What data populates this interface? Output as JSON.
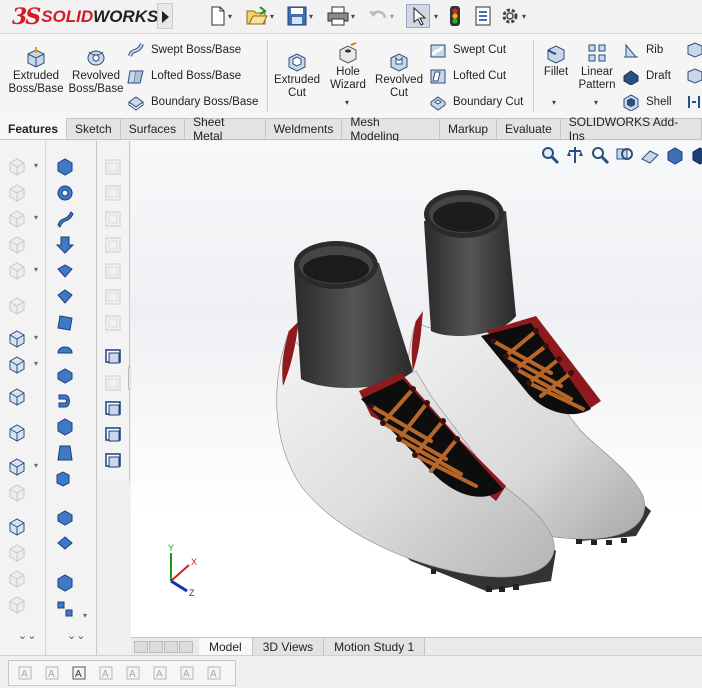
{
  "app": {
    "logo_mark": "3S",
    "logo_solid": "SOLID",
    "logo_works": "WORKS"
  },
  "quick_access": [
    {
      "name": "new-document",
      "icon": "new-file-icon"
    },
    {
      "name": "open",
      "icon": "open-folder-icon"
    },
    {
      "name": "save",
      "icon": "save-icon"
    },
    {
      "name": "print",
      "icon": "printer-icon"
    },
    {
      "name": "undo",
      "icon": "undo-icon"
    },
    {
      "name": "select",
      "icon": "cursor-icon"
    },
    {
      "name": "rebuild",
      "icon": "traffic-light-icon"
    },
    {
      "name": "file-properties",
      "icon": "file-properties-icon"
    },
    {
      "name": "options",
      "icon": "gear-icon"
    }
  ],
  "commands": {
    "extruded_boss": "Extruded\nBoss/Base",
    "revolved_boss": "Revolved\nBoss/Base",
    "swept_boss": "Swept Boss/Base",
    "lofted_boss": "Lofted Boss/Base",
    "boundary_boss": "Boundary Boss/Base",
    "extruded_cut": "Extruded\nCut",
    "hole_wizard": "Hole\nWizard",
    "revolved_cut": "Revolved\nCut",
    "swept_cut": "Swept Cut",
    "lofted_cut": "Lofted Cut",
    "boundary_cut": "Boundary Cut",
    "fillet": "Fillet",
    "linear_pattern": "Linear\nPattern",
    "rib": "Rib",
    "draft": "Draft",
    "shell": "Shell"
  },
  "tabs": [
    "Features",
    "Sketch",
    "Surfaces",
    "Sheet Metal",
    "Weldments",
    "Mesh Modeling",
    "Markup",
    "Evaluate",
    "SOLIDWORKS Add-Ins"
  ],
  "active_tab": "Features",
  "bottom_tabs": [
    "Model",
    "3D Views",
    "Motion Study 1"
  ],
  "active_bottom_tab": "Model",
  "triad": {
    "x": "X",
    "y": "Y",
    "z": "Z"
  },
  "colors": {
    "brand_red": "#d31b24",
    "shoe_body": "#d9d9d9",
    "shoe_collar": "#3a3a3a",
    "shoe_eyestay": "#9b1b1f",
    "laces": "#b8652a"
  }
}
